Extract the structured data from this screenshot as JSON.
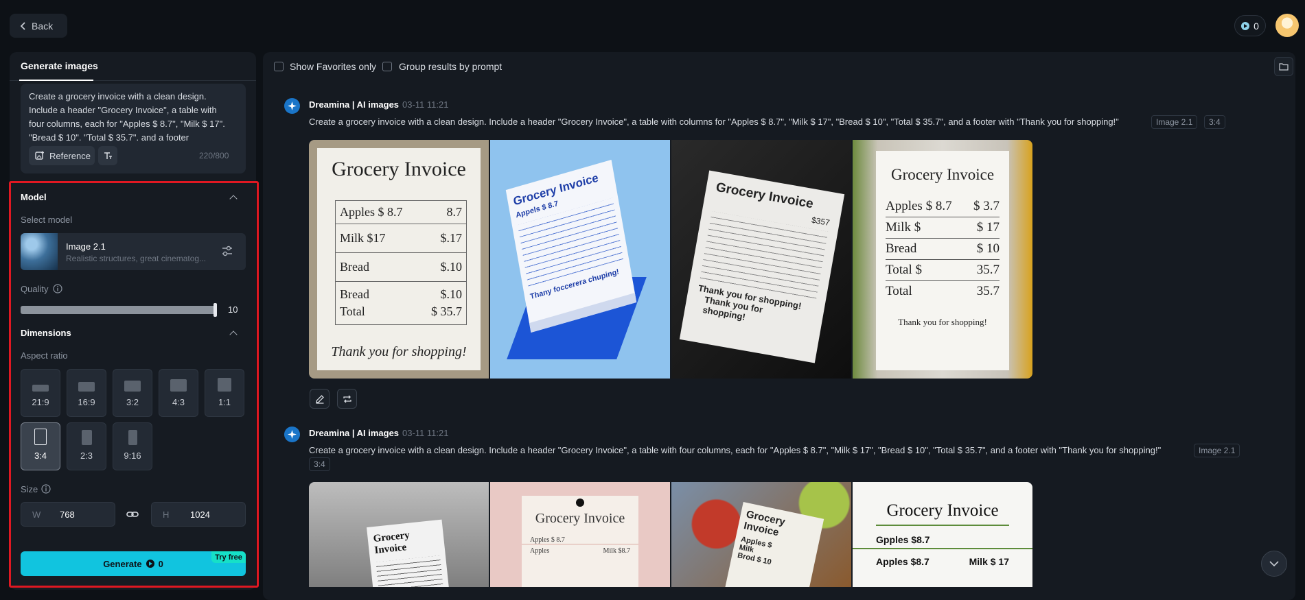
{
  "header": {
    "back_label": "Back",
    "credits": "0"
  },
  "left_panel": {
    "tab_label": "Generate images",
    "prompt_text": "Create a grocery invoice with a clean design. Include a header \"Grocery Invoice\", a table with four columns, each for \"Apples $ 8.7\", \"Milk $ 17\". \"Bread $ 10\". \"Total $ 35.7\". and a footer",
    "reference_label": "Reference",
    "char_count": "220/800",
    "model": {
      "section_title": "Model",
      "select_label": "Select model",
      "name": "Image 2.1",
      "description": "Realistic structures, great cinematog..."
    },
    "quality": {
      "label": "Quality",
      "value": "10",
      "level": 1.0
    },
    "dimensions": {
      "section_title": "Dimensions",
      "aspect_label": "Aspect ratio",
      "ratios": [
        "21:9",
        "16:9",
        "3:2",
        "4:3",
        "1:1",
        "3:4",
        "2:3",
        "9:16"
      ],
      "selected_ratio": "3:4"
    },
    "size": {
      "label": "Size",
      "w_prefix": "W",
      "w_value": "768",
      "h_prefix": "H",
      "h_value": "1024"
    },
    "generate": {
      "label": "Generate",
      "cost": "0",
      "badge": "Try free"
    }
  },
  "toolbar": {
    "favorites_label": "Show Favorites only",
    "group_label": "Group results by prompt"
  },
  "generations": [
    {
      "author": "Dreamina | AI images",
      "time": "03-11  11:21",
      "prompt": "Create a grocery invoice with a clean design. Include a header \"Grocery Invoice\", a table with columns for \"Apples $ 8.7\", \"Milk $ 17\", \"Bread $ 10\", \"Total $ 35.7\", and a footer with \"Thank you for shopping!\"",
      "model_tag": "Image 2.1",
      "ratio_tag": "3:4"
    },
    {
      "author": "Dreamina | AI images",
      "time": "03-11  11:21",
      "prompt": "Create a grocery invoice with a clean design. Include a header \"Grocery Invoice\", a table with four columns, each for \"Apples $ 8.7\", \"Milk $ 17\", \"Bread $ 10\", \"Total $ 35.7\", and a footer with \"Thank you for shopping!\"",
      "model_tag": "Image 2.1",
      "ratio_tag": "3:4"
    }
  ],
  "images": {
    "a1": {
      "title": "Grocery Invoice",
      "rows": [
        [
          "Apples $ 8.7",
          "8.7"
        ],
        [
          "Milk $17",
          "$.17"
        ],
        [
          "Bread",
          "$.10"
        ],
        [
          "Bread",
          "$.10"
        ],
        [
          "Total",
          "$ 35.7"
        ]
      ],
      "footer": "Thank you for shopping!"
    },
    "a2": {
      "title": "Grocery Invoice",
      "line1": "Appels $ 8.7",
      "line2": "Thany foccerera chuping!"
    },
    "a3": {
      "title": "Grocery Invoice",
      "amount": "$357",
      "footer1": "Thank you for shopping!",
      "footer2": "Thank you for shopping!"
    },
    "a4": {
      "title": "Grocery Invoice",
      "rows": [
        [
          "Apples $ 8.7",
          "$ 3.7"
        ],
        [
          "Milk $",
          "$ 17"
        ],
        [
          "Bread",
          "$ 10"
        ],
        [
          "Total $",
          "35.7"
        ],
        [
          "Total",
          "35.7"
        ]
      ],
      "footer": "Thank you for shopping!"
    },
    "b1": {
      "title": "Grocery Invoice"
    },
    "b2": {
      "title": "Grocery Invoice",
      "row1": "Apples $ 8.7",
      "row2a": "Apples",
      "row2b": "Milk $8.7"
    },
    "b3": {
      "title": "Grocery Invoice",
      "row1": "Apples $",
      "row2": "Brod $ 10",
      "row3": "Milk"
    },
    "b4": {
      "title": "Grocery Invoice",
      "row1": "Gpples $8.7",
      "row2a": "Apples $8.7",
      "row2b": "Milk $ 17"
    }
  }
}
